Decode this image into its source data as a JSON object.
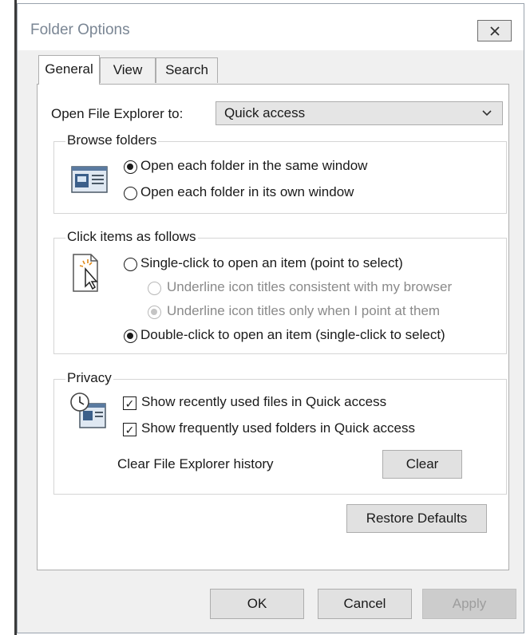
{
  "window": {
    "title": "Folder Options",
    "close_glyph": "✕"
  },
  "tabs": [
    {
      "label": "General",
      "active": true
    },
    {
      "label": "View",
      "active": false
    },
    {
      "label": "Search",
      "active": false
    }
  ],
  "open_explorer": {
    "label": "Open File Explorer to:",
    "value": "Quick access"
  },
  "browse_folders": {
    "legend": "Browse folders",
    "options": [
      {
        "label": "Open each folder in the same window",
        "selected": true
      },
      {
        "label": "Open each folder in its own window",
        "selected": false
      }
    ]
  },
  "click_items": {
    "legend": "Click items as follows",
    "options": {
      "single": "Single-click to open an item (point to select)",
      "underline_browser": "Underline icon titles consistent with my browser",
      "underline_point": "Underline icon titles only when I point at them",
      "double": "Double-click to open an item (single-click to select)"
    },
    "selected": "double"
  },
  "privacy": {
    "legend": "Privacy",
    "recent_files": {
      "label": "Show recently used files in Quick access",
      "checked": true
    },
    "frequent_folders": {
      "label": "Show frequently used folders in Quick access",
      "checked": true
    },
    "clear_history_label": "Clear File Explorer history",
    "clear_button": "Clear"
  },
  "restore_defaults": "Restore Defaults",
  "footer": {
    "ok": "OK",
    "cancel": "Cancel",
    "apply": "Apply"
  },
  "check_glyph": "✓",
  "dropdown_glyph": "⌵"
}
